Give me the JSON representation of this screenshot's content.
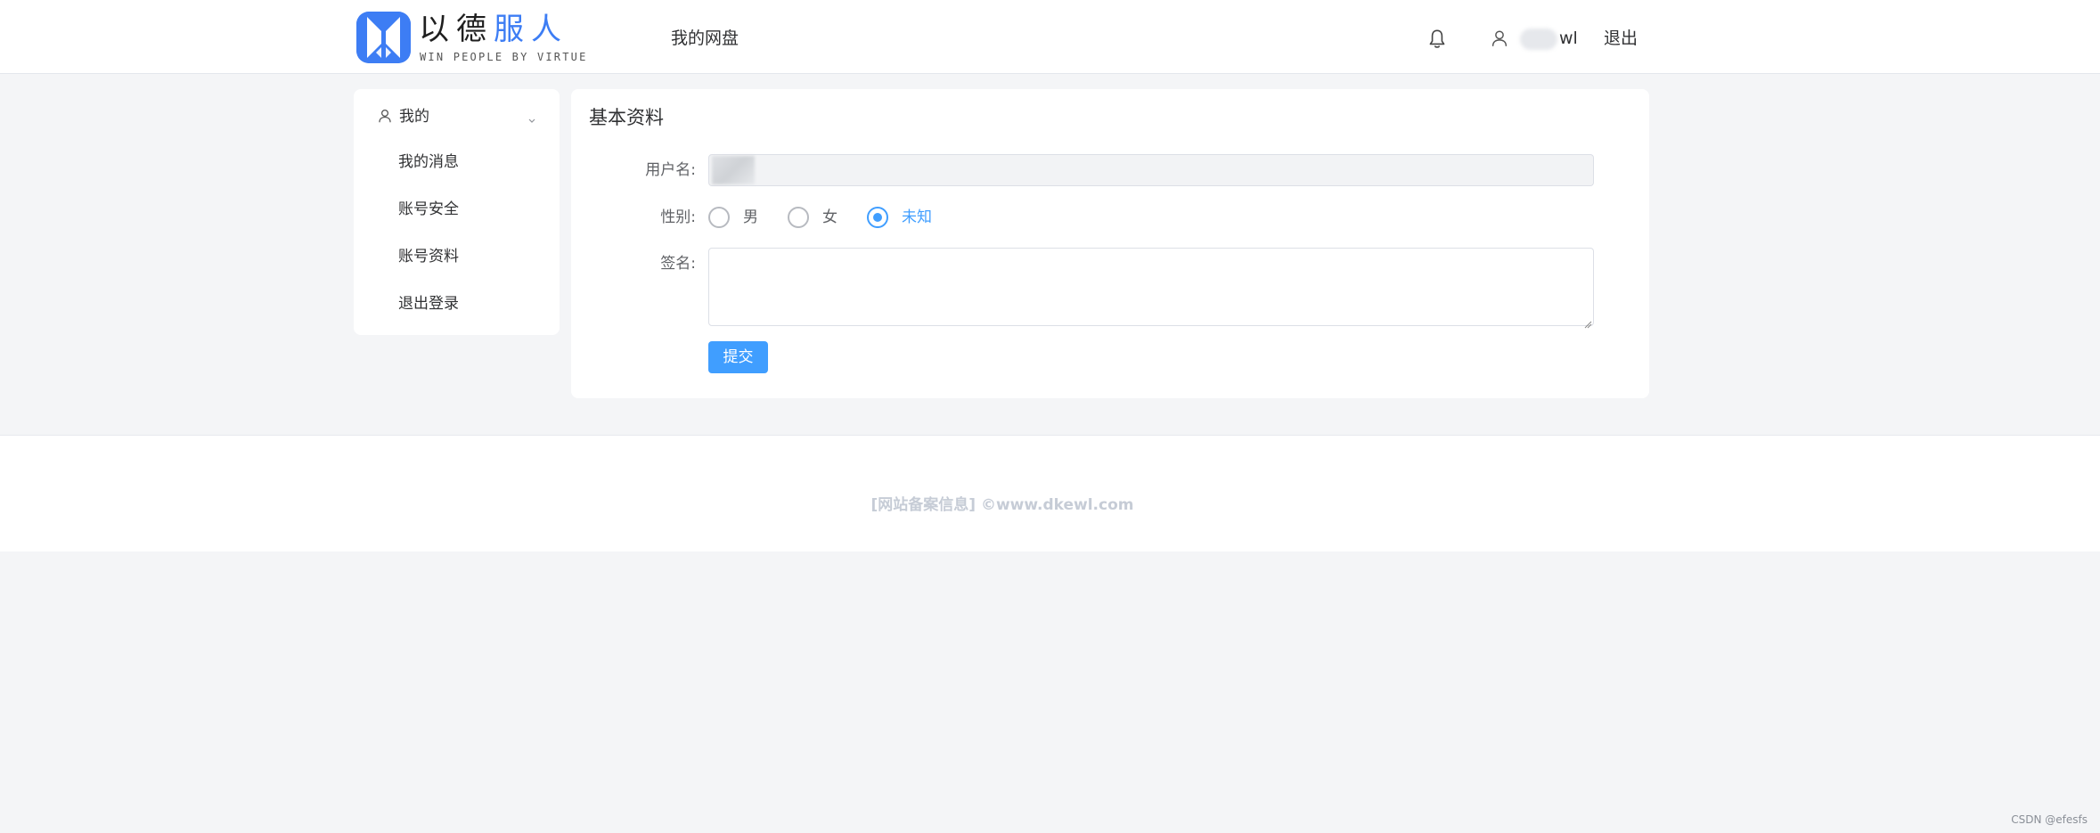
{
  "header": {
    "logo": {
      "title_part1": "以德",
      "title_part2": "服人",
      "subtitle": "WIN PEOPLE BY VIRTUE"
    },
    "nav_disk_label": "我的网盘",
    "bell_icon": "bell-icon",
    "user_icon": "user-icon",
    "username_visible": "wl",
    "logout_label": "退出"
  },
  "sidebar": {
    "group_label": "我的",
    "items": [
      {
        "label": "我的消息"
      },
      {
        "label": "账号安全"
      },
      {
        "label": "账号资料"
      },
      {
        "label": "退出登录"
      }
    ]
  },
  "profile": {
    "title": "基本资料",
    "username_label": "用户名:",
    "gender_label": "性别:",
    "gender_options": [
      {
        "label": "男",
        "selected": false
      },
      {
        "label": "女",
        "selected": false
      },
      {
        "label": "未知",
        "selected": true
      }
    ],
    "signature_label": "签名:",
    "signature_value": "",
    "submit_label": "提交"
  },
  "footer": {
    "text": "[网站备案信息] ©www.dkewl.com"
  },
  "watermark": "CSDN @efesfs",
  "colors": {
    "accent": "#409eff",
    "logo_blue": "#3d7df4",
    "page_bg": "#f4f5f7",
    "footer_text": "#c6ccd6"
  }
}
